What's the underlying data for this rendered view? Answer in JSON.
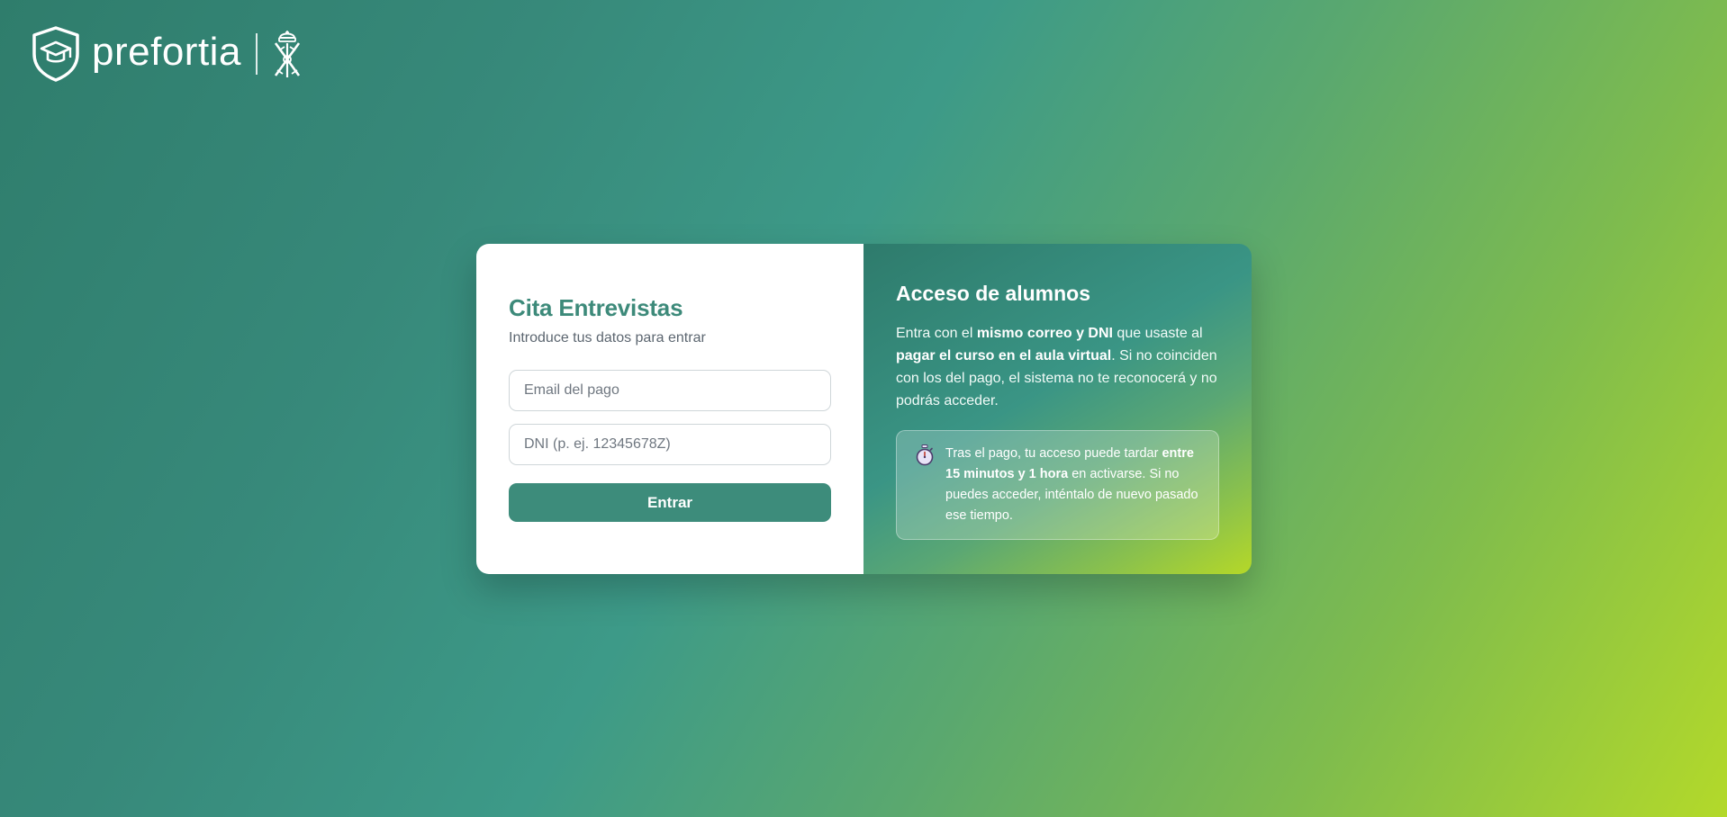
{
  "brand": {
    "name": "prefortia",
    "logo_icon": "graduation-cap-shield-icon",
    "crest_icon": "guardia-civil-crest-icon"
  },
  "login": {
    "title": "Cita Entrevistas",
    "subtitle": "Introduce tus datos para entrar",
    "email_placeholder": "Email del pago",
    "email_value": "",
    "dni_placeholder": "DNI (p. ej. 12345678Z)",
    "dni_value": "",
    "submit_label": "Entrar"
  },
  "info": {
    "title": "Acceso de alumnos",
    "desc_1": "Entra con el ",
    "desc_bold_1": "mismo correo y DNI",
    "desc_2": " que usaste al ",
    "desc_bold_2": "pagar el curso en el aula virtual",
    "desc_3": ". Si no coinciden con los del pago, el sistema no te reconocerá y no podrás acceder.",
    "notice": {
      "icon": "stopwatch-icon",
      "text_1": "Tras el pago, tu acceso puede tardar ",
      "text_bold": "entre 15 minutos y 1 hora",
      "text_2": " en activarse. Si no puedes acceder, inténtalo de nuevo pasado ese tiempo."
    }
  },
  "colors": {
    "accent": "#3d8c7b",
    "title_green": "#3d8a7a",
    "gradient_start": "#2f7d6c",
    "gradient_end": "#b3d92a"
  }
}
